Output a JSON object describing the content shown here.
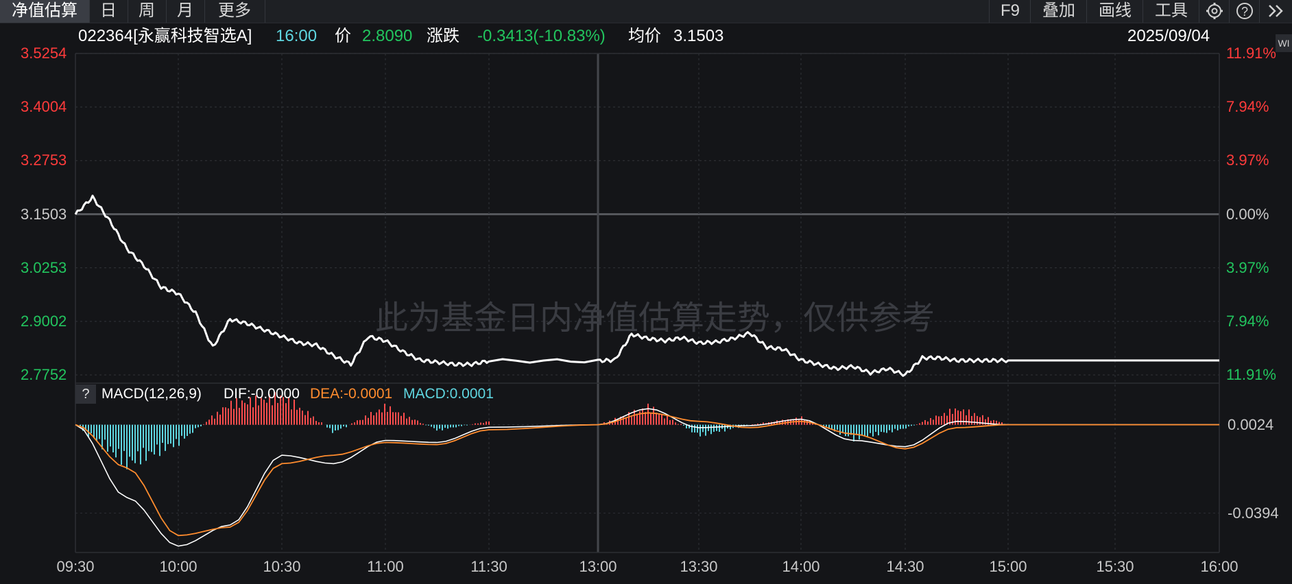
{
  "toolbar": {
    "tabs": [
      "净值估算",
      "日",
      "周",
      "月",
      "更多"
    ],
    "right_tools": [
      "F9",
      "叠加",
      "画线",
      "工具"
    ],
    "icons": [
      "gear-icon",
      "help-icon",
      "expand-icon"
    ],
    "right_edge_label": "WI"
  },
  "info": {
    "code_name": "022364[永赢科技智选A]",
    "time": "16:00",
    "price_label": "价",
    "price": "2.8090",
    "change_label": "涨跌",
    "change": "-0.3413(-10.83%)",
    "avg_label": "均价",
    "avg": "3.1503",
    "date": "2025/09/04"
  },
  "colors": {
    "background": "#141518",
    "up": "#ff3b3b",
    "down": "#22c55e",
    "cyan": "#5fd6e0",
    "orange": "#ff8c2e",
    "line": "#ffffff"
  },
  "watermark": "此为基金日内净值估算走势，仅供参考",
  "chart_data": [
    {
      "type": "line",
      "name": "intraday-nav",
      "x_ticks": [
        "09:30",
        "10:00",
        "10:30",
        "11:00",
        "11:30",
        "13:00",
        "13:30",
        "14:00",
        "14:30",
        "15:00",
        "15:30",
        "16:00"
      ],
      "y_ticks_left": [
        "3.5254",
        "3.4004",
        "3.2753",
        "3.1503",
        "3.0253",
        "2.9002",
        "2.7752"
      ],
      "y_ticks_right": [
        "11.91%",
        "7.94%",
        "3.97%",
        "0.00%",
        "3.97%",
        "7.94%",
        "11.91%"
      ],
      "ylim": [
        2.7752,
        3.5254
      ],
      "reference": 3.1503,
      "x": [
        "09:30",
        "09:35",
        "09:40",
        "09:45",
        "09:50",
        "09:55",
        "10:00",
        "10:05",
        "10:10",
        "10:15",
        "10:20",
        "10:25",
        "10:30",
        "10:35",
        "10:40",
        "10:45",
        "10:50",
        "10:55",
        "11:00",
        "11:05",
        "11:10",
        "11:15",
        "11:20",
        "11:25",
        "11:30",
        "13:00",
        "13:05",
        "13:10",
        "13:15",
        "13:20",
        "13:25",
        "13:30",
        "13:35",
        "13:40",
        "13:45",
        "13:50",
        "13:55",
        "14:00",
        "14:05",
        "14:10",
        "14:15",
        "14:20",
        "14:25",
        "14:30",
        "14:35",
        "14:40",
        "14:45",
        "14:50",
        "14:55",
        "15:00",
        "15:30",
        "16:00"
      ],
      "values": [
        3.15,
        3.19,
        3.135,
        3.07,
        3.03,
        2.98,
        2.965,
        2.92,
        2.84,
        2.905,
        2.895,
        2.88,
        2.865,
        2.85,
        2.845,
        2.82,
        2.8,
        2.865,
        2.855,
        2.83,
        2.81,
        2.805,
        2.8,
        2.8,
        2.808,
        2.808,
        2.81,
        2.87,
        2.86,
        2.855,
        2.862,
        2.85,
        2.852,
        2.86,
        2.873,
        2.84,
        2.835,
        2.81,
        2.8,
        2.79,
        2.795,
        2.78,
        2.79,
        2.775,
        2.815,
        2.815,
        2.809,
        2.809,
        2.809,
        2.809,
        2.809,
        2.809
      ]
    },
    {
      "type": "line",
      "name": "macd",
      "title": "MACD(12,26,9)",
      "dif": "DIF:-0.0000",
      "dea": "DEA:-0.0001",
      "macd": "MACD:0.0001",
      "y_ticks": [
        "0.0024",
        "-0.0394"
      ],
      "ylim": [
        -0.058,
        0.012
      ],
      "x": [
        "09:30",
        "09:45",
        "10:00",
        "10:15",
        "10:30",
        "10:45",
        "11:00",
        "11:15",
        "11:30",
        "13:00",
        "13:15",
        "13:30",
        "13:45",
        "14:00",
        "14:15",
        "14:30",
        "14:45",
        "15:00",
        "16:00"
      ],
      "dif_values": [
        0.0024,
        -0.032,
        -0.055,
        -0.045,
        -0.012,
        -0.016,
        -0.005,
        -0.006,
        0.0012,
        0.0024,
        0.01,
        0.001,
        0.002,
        0.005,
        -0.005,
        -0.008,
        0.004,
        0.0024,
        0.0024
      ],
      "dea_values": [
        0.0024,
        -0.018,
        -0.05,
        -0.046,
        -0.016,
        -0.012,
        -0.006,
        -0.007,
        0.0,
        0.0024,
        0.008,
        0.004,
        0.001,
        0.004,
        -0.002,
        -0.009,
        0.001,
        0.0024,
        0.0024
      ],
      "hist_values": [
        0.0,
        -0.022,
        -0.01,
        0.012,
        0.016,
        -0.004,
        0.01,
        -0.003,
        0.002,
        0.0,
        0.01,
        -0.006,
        0.0,
        0.004,
        -0.008,
        -0.002,
        0.009,
        0.0,
        0.0
      ]
    }
  ]
}
